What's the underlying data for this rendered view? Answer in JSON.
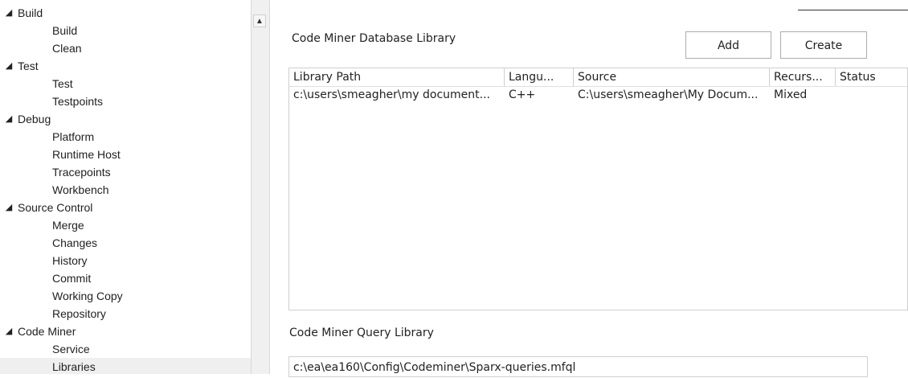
{
  "tree": {
    "items": [
      {
        "label": "Build",
        "level": 0,
        "expanded": true
      },
      {
        "label": "Build",
        "level": 1
      },
      {
        "label": "Clean",
        "level": 1
      },
      {
        "label": "Test",
        "level": 0,
        "expanded": true
      },
      {
        "label": "Test",
        "level": 1
      },
      {
        "label": "Testpoints",
        "level": 1
      },
      {
        "label": "Debug",
        "level": 0,
        "expanded": true
      },
      {
        "label": "Platform",
        "level": 1
      },
      {
        "label": "Runtime Host",
        "level": 1
      },
      {
        "label": "Tracepoints",
        "level": 1
      },
      {
        "label": "Workbench",
        "level": 1
      },
      {
        "label": "Source Control",
        "level": 0,
        "expanded": true
      },
      {
        "label": "Merge",
        "level": 1
      },
      {
        "label": "Changes",
        "level": 1
      },
      {
        "label": "History",
        "level": 1
      },
      {
        "label": "Commit",
        "level": 1
      },
      {
        "label": "Working Copy",
        "level": 1
      },
      {
        "label": "Repository",
        "level": 1
      },
      {
        "label": "Code Miner",
        "level": 0,
        "expanded": true
      },
      {
        "label": "Service",
        "level": 1
      },
      {
        "label": "Libraries",
        "level": 1,
        "selected": true
      }
    ],
    "expander_glyph": "◢"
  },
  "scrollbar": {
    "up_glyph": "▲"
  },
  "db_library": {
    "title": "Code Miner Database Library",
    "add_label": "Add",
    "create_label": "Create",
    "columns": [
      "Library Path",
      "Langu...",
      "Source",
      "Recurs...",
      "Status"
    ],
    "rows": [
      [
        "c:\\users\\smeagher\\my document...",
        "C++",
        "C:\\users\\smeagher\\My Docum...",
        "Mixed",
        ""
      ]
    ]
  },
  "query_library": {
    "title": "Code Miner Query Library",
    "path": "c:\\ea\\ea160\\Config\\Codeminer\\Sparx-queries.mfql"
  },
  "colors": {
    "selected_bg": "#efefef",
    "border": "#cfcfcf"
  }
}
